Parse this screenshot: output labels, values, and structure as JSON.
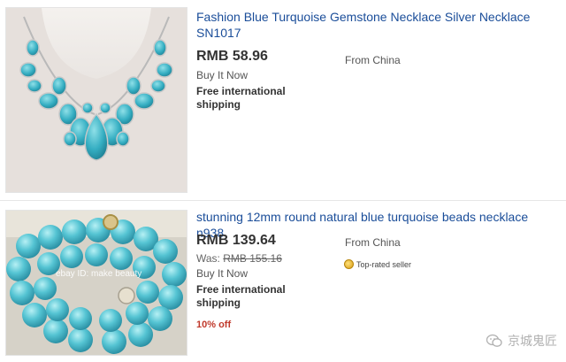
{
  "listings": [
    {
      "title": "Fashion Blue Turquoise Gemstone Necklace Silver Necklace SN1017",
      "price": "RMB 58.96",
      "format": "Buy It Now",
      "shipping": "Free international shipping",
      "location": "From China"
    },
    {
      "title": "stunning 12mm round natural blue turquoise beads necklace n938",
      "price": "RMB 139.64",
      "was_label": "Was:",
      "was_price": "RMB 155.16",
      "format": "Buy It Now",
      "shipping": "Free international shipping",
      "location": "From China",
      "badge": "Top-rated seller",
      "discount": "10% off",
      "image_watermark": "ebay ID: make beauty"
    }
  ],
  "watermark": {
    "text": "京城鬼匠",
    "icon": "wechat-icon"
  },
  "colors": {
    "link": "#1a4d99",
    "discount": "#c0392b",
    "turquoise": "#3fb7c9"
  }
}
